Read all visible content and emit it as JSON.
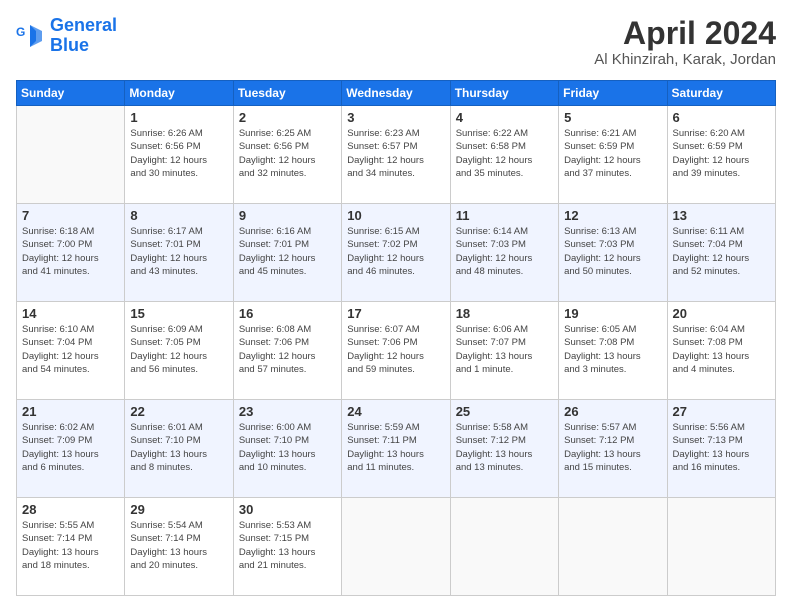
{
  "header": {
    "logo_line1": "General",
    "logo_line2": "Blue",
    "title": "April 2024",
    "location": "Al Khinzirah, Karak, Jordan"
  },
  "days_of_week": [
    "Sunday",
    "Monday",
    "Tuesday",
    "Wednesday",
    "Thursday",
    "Friday",
    "Saturday"
  ],
  "weeks": [
    [
      {
        "num": "",
        "info": ""
      },
      {
        "num": "1",
        "info": "Sunrise: 6:26 AM\nSunset: 6:56 PM\nDaylight: 12 hours\nand 30 minutes."
      },
      {
        "num": "2",
        "info": "Sunrise: 6:25 AM\nSunset: 6:56 PM\nDaylight: 12 hours\nand 32 minutes."
      },
      {
        "num": "3",
        "info": "Sunrise: 6:23 AM\nSunset: 6:57 PM\nDaylight: 12 hours\nand 34 minutes."
      },
      {
        "num": "4",
        "info": "Sunrise: 6:22 AM\nSunset: 6:58 PM\nDaylight: 12 hours\nand 35 minutes."
      },
      {
        "num": "5",
        "info": "Sunrise: 6:21 AM\nSunset: 6:59 PM\nDaylight: 12 hours\nand 37 minutes."
      },
      {
        "num": "6",
        "info": "Sunrise: 6:20 AM\nSunset: 6:59 PM\nDaylight: 12 hours\nand 39 minutes."
      }
    ],
    [
      {
        "num": "7",
        "info": "Sunrise: 6:18 AM\nSunset: 7:00 PM\nDaylight: 12 hours\nand 41 minutes."
      },
      {
        "num": "8",
        "info": "Sunrise: 6:17 AM\nSunset: 7:01 PM\nDaylight: 12 hours\nand 43 minutes."
      },
      {
        "num": "9",
        "info": "Sunrise: 6:16 AM\nSunset: 7:01 PM\nDaylight: 12 hours\nand 45 minutes."
      },
      {
        "num": "10",
        "info": "Sunrise: 6:15 AM\nSunset: 7:02 PM\nDaylight: 12 hours\nand 46 minutes."
      },
      {
        "num": "11",
        "info": "Sunrise: 6:14 AM\nSunset: 7:03 PM\nDaylight: 12 hours\nand 48 minutes."
      },
      {
        "num": "12",
        "info": "Sunrise: 6:13 AM\nSunset: 7:03 PM\nDaylight: 12 hours\nand 50 minutes."
      },
      {
        "num": "13",
        "info": "Sunrise: 6:11 AM\nSunset: 7:04 PM\nDaylight: 12 hours\nand 52 minutes."
      }
    ],
    [
      {
        "num": "14",
        "info": "Sunrise: 6:10 AM\nSunset: 7:04 PM\nDaylight: 12 hours\nand 54 minutes."
      },
      {
        "num": "15",
        "info": "Sunrise: 6:09 AM\nSunset: 7:05 PM\nDaylight: 12 hours\nand 56 minutes."
      },
      {
        "num": "16",
        "info": "Sunrise: 6:08 AM\nSunset: 7:06 PM\nDaylight: 12 hours\nand 57 minutes."
      },
      {
        "num": "17",
        "info": "Sunrise: 6:07 AM\nSunset: 7:06 PM\nDaylight: 12 hours\nand 59 minutes."
      },
      {
        "num": "18",
        "info": "Sunrise: 6:06 AM\nSunset: 7:07 PM\nDaylight: 13 hours\nand 1 minute."
      },
      {
        "num": "19",
        "info": "Sunrise: 6:05 AM\nSunset: 7:08 PM\nDaylight: 13 hours\nand 3 minutes."
      },
      {
        "num": "20",
        "info": "Sunrise: 6:04 AM\nSunset: 7:08 PM\nDaylight: 13 hours\nand 4 minutes."
      }
    ],
    [
      {
        "num": "21",
        "info": "Sunrise: 6:02 AM\nSunset: 7:09 PM\nDaylight: 13 hours\nand 6 minutes."
      },
      {
        "num": "22",
        "info": "Sunrise: 6:01 AM\nSunset: 7:10 PM\nDaylight: 13 hours\nand 8 minutes."
      },
      {
        "num": "23",
        "info": "Sunrise: 6:00 AM\nSunset: 7:10 PM\nDaylight: 13 hours\nand 10 minutes."
      },
      {
        "num": "24",
        "info": "Sunrise: 5:59 AM\nSunset: 7:11 PM\nDaylight: 13 hours\nand 11 minutes."
      },
      {
        "num": "25",
        "info": "Sunrise: 5:58 AM\nSunset: 7:12 PM\nDaylight: 13 hours\nand 13 minutes."
      },
      {
        "num": "26",
        "info": "Sunrise: 5:57 AM\nSunset: 7:12 PM\nDaylight: 13 hours\nand 15 minutes."
      },
      {
        "num": "27",
        "info": "Sunrise: 5:56 AM\nSunset: 7:13 PM\nDaylight: 13 hours\nand 16 minutes."
      }
    ],
    [
      {
        "num": "28",
        "info": "Sunrise: 5:55 AM\nSunset: 7:14 PM\nDaylight: 13 hours\nand 18 minutes."
      },
      {
        "num": "29",
        "info": "Sunrise: 5:54 AM\nSunset: 7:14 PM\nDaylight: 13 hours\nand 20 minutes."
      },
      {
        "num": "30",
        "info": "Sunrise: 5:53 AM\nSunset: 7:15 PM\nDaylight: 13 hours\nand 21 minutes."
      },
      {
        "num": "",
        "info": ""
      },
      {
        "num": "",
        "info": ""
      },
      {
        "num": "",
        "info": ""
      },
      {
        "num": "",
        "info": ""
      }
    ]
  ]
}
